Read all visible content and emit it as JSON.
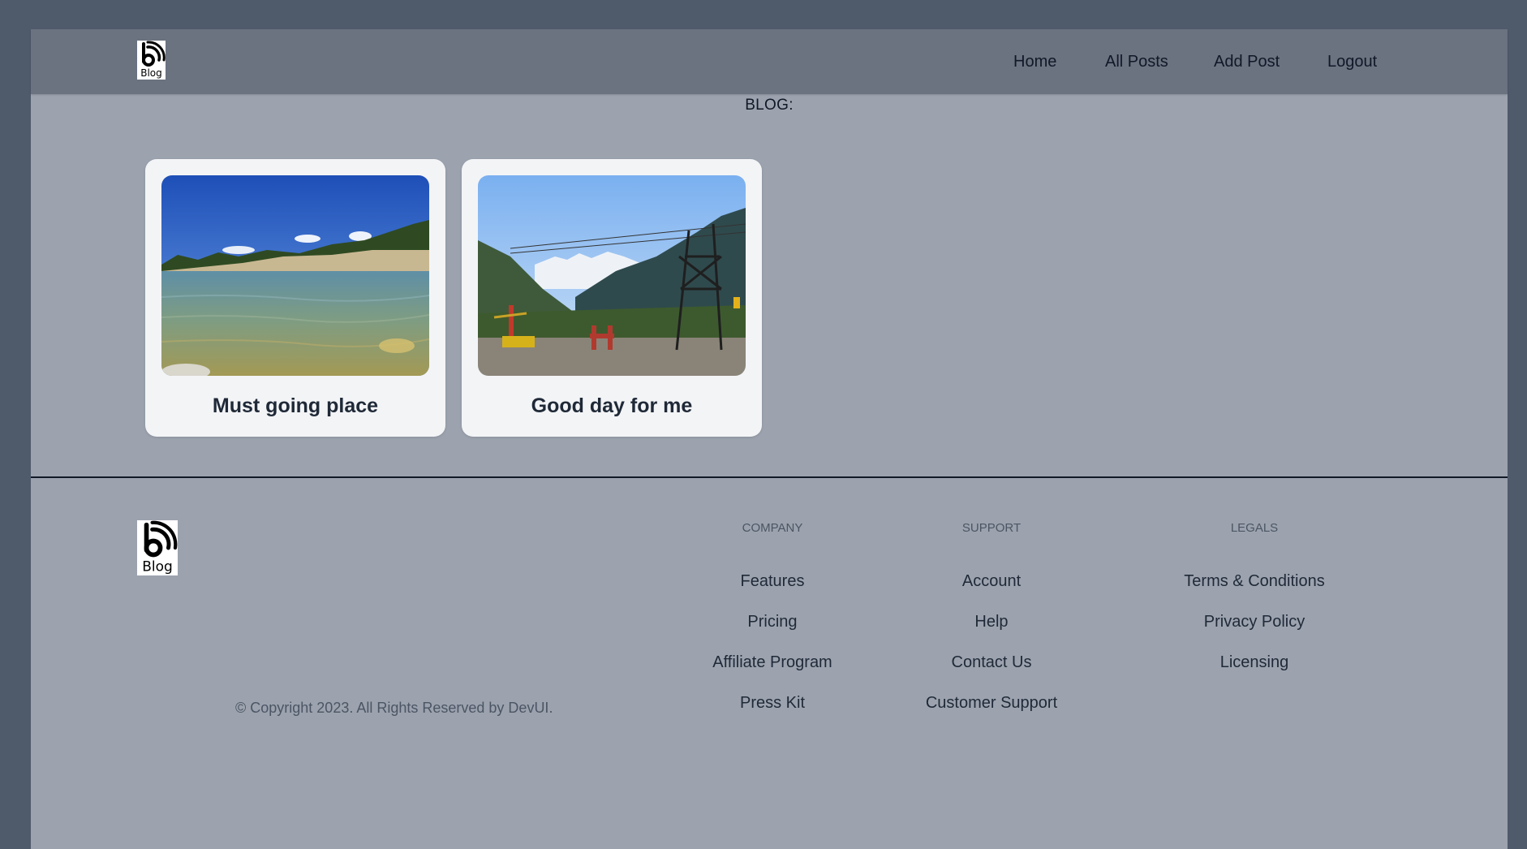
{
  "header": {
    "logo_text": "Blog",
    "nav": [
      {
        "label": "Home"
      },
      {
        "label": "All Posts"
      },
      {
        "label": "Add Post"
      },
      {
        "label": "Logout"
      }
    ]
  },
  "main": {
    "heading": "BLOG:",
    "posts": [
      {
        "title": "Must going place"
      },
      {
        "title": "Good day for me"
      }
    ]
  },
  "footer": {
    "logo_text": "Blog",
    "columns": [
      {
        "heading": "COMPANY",
        "links": [
          "Features",
          "Pricing",
          "Affiliate Program",
          "Press Kit"
        ]
      },
      {
        "heading": "SUPPORT",
        "links": [
          "Account",
          "Help",
          "Contact Us",
          "Customer Support"
        ]
      },
      {
        "heading": "LEGALS",
        "links": [
          "Terms & Conditions",
          "Privacy Policy",
          "Licensing"
        ]
      }
    ],
    "copyright": "© Copyright 2023. All Rights Reserved by DevUI."
  },
  "colors": {
    "outer_background": "#4f5a6b",
    "header_background": "#6b7280",
    "page_background": "#9ca3af",
    "card_background": "#f3f4f6",
    "text_dark": "#1f2937",
    "text_muted": "#4b5563"
  }
}
